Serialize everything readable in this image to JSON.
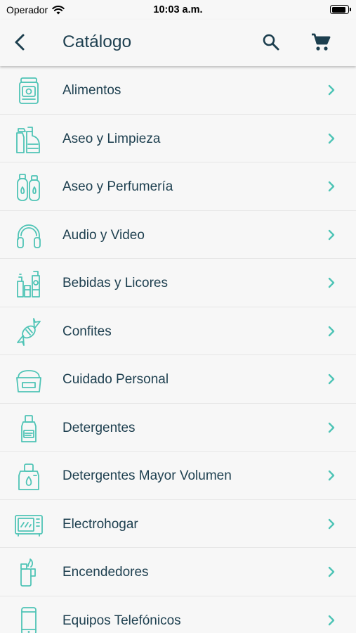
{
  "status_bar": {
    "carrier": "Operador",
    "time": "10:03 a.m.",
    "battery_level": 0.95
  },
  "nav": {
    "title": "Catálogo",
    "back_icon": "chevron-left-icon",
    "search_icon": "search-icon",
    "cart_icon": "cart-icon"
  },
  "colors": {
    "accent": "#4fc4b6",
    "text": "#1d3f4f",
    "background": "#f7f7f7"
  },
  "categories": [
    {
      "label": "Alimentos",
      "icon": "food-jar-icon"
    },
    {
      "label": "Aseo y Limpieza",
      "icon": "cleaning-products-icon"
    },
    {
      "label": "Aseo y Perfumería",
      "icon": "perfume-bottles-icon"
    },
    {
      "label": "Audio y Video",
      "icon": "headphones-icon"
    },
    {
      "label": "Bebidas y Licores",
      "icon": "beverages-icon"
    },
    {
      "label": "Confites",
      "icon": "candy-icon"
    },
    {
      "label": "Cuidado Personal",
      "icon": "cream-jar-icon"
    },
    {
      "label": "Detergentes",
      "icon": "detergent-bottle-icon"
    },
    {
      "label": "Detergentes Mayor Volumen",
      "icon": "large-detergent-icon"
    },
    {
      "label": "Electrohogar",
      "icon": "microwave-icon"
    },
    {
      "label": "Encendedores",
      "icon": "lighter-icon"
    },
    {
      "label": "Equipos Telefónicos",
      "icon": "phone-icon"
    }
  ]
}
